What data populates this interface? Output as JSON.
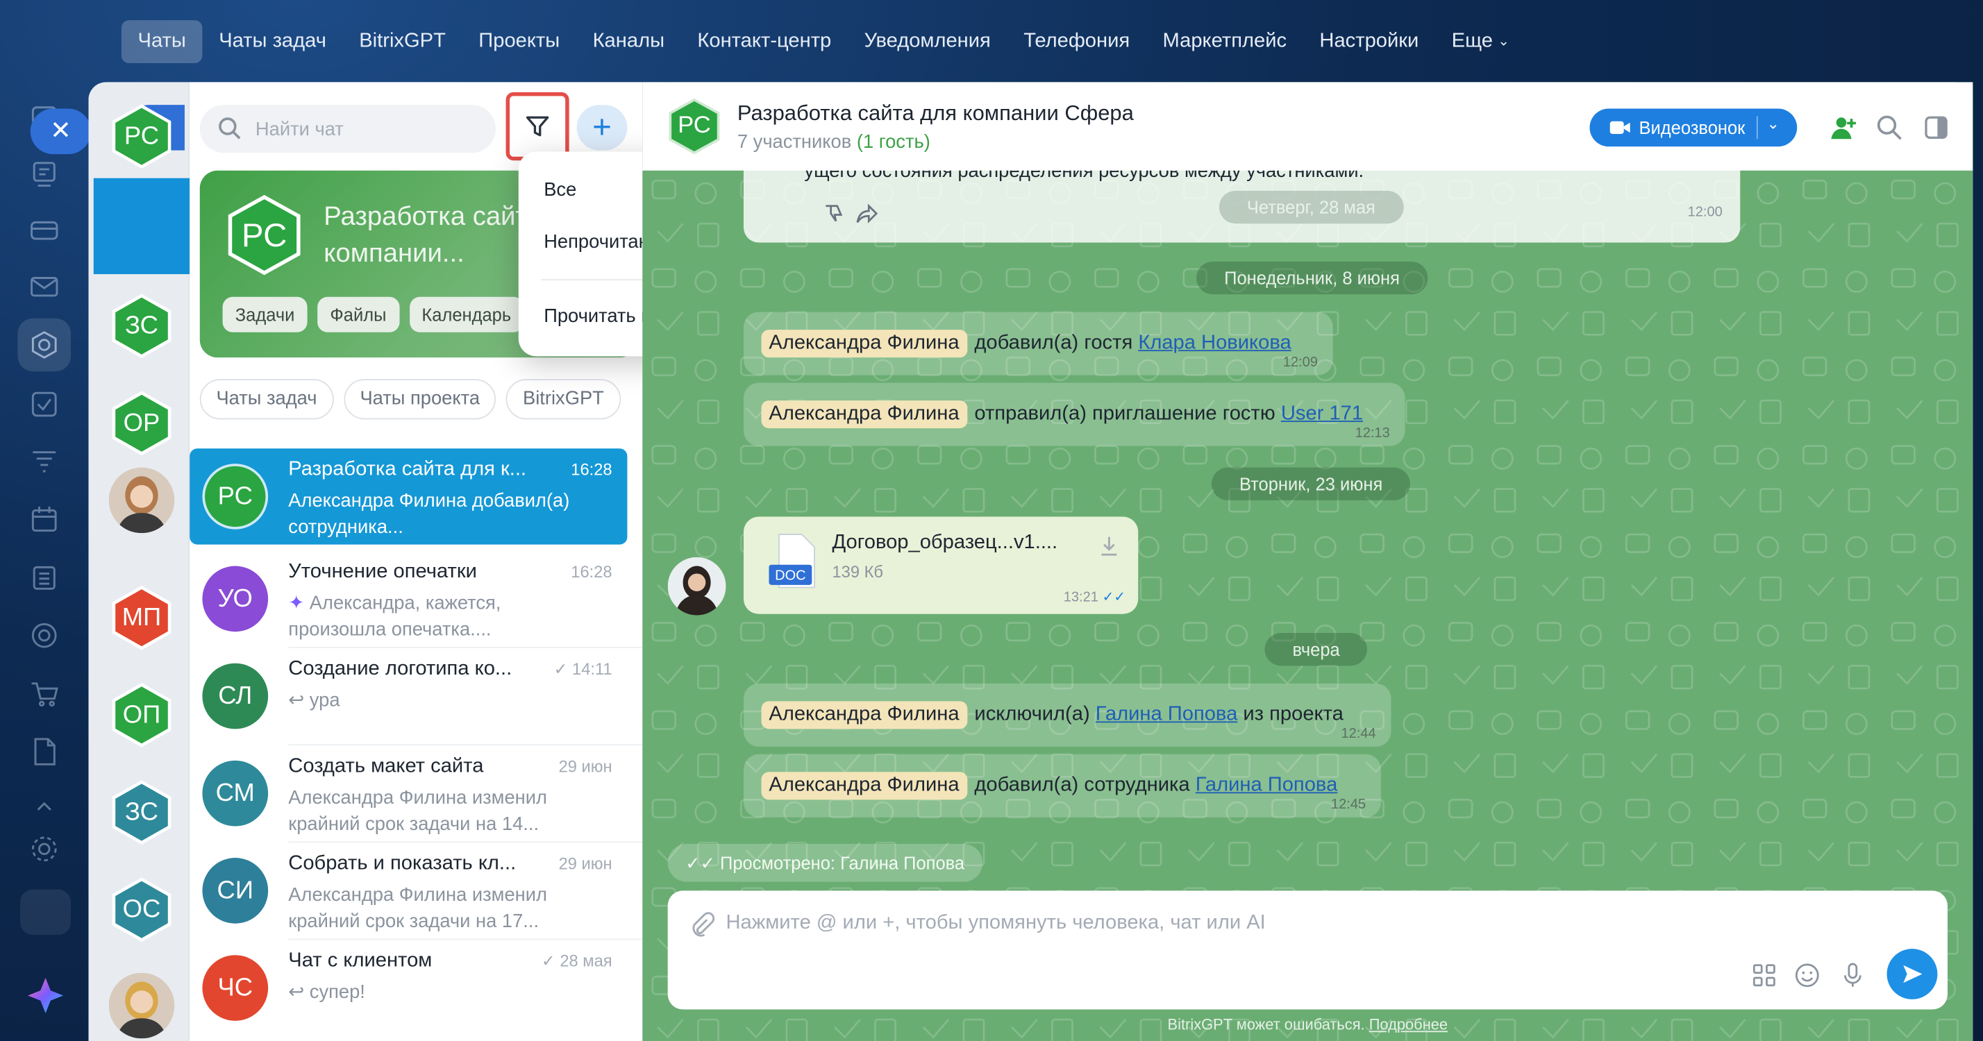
{
  "nav": {
    "items": [
      "Чаты",
      "Чаты задач",
      "BitrixGPT",
      "Проекты",
      "Каналы",
      "Контакт-центр",
      "Уведомления",
      "Телефония",
      "Маркетплейс",
      "Настройки"
    ],
    "more": "Еще",
    "active_index": 0
  },
  "rail": {
    "icons": [
      "chat-icon",
      "tasks-icon",
      "card-icon",
      "mail-icon",
      "hexagon-icon",
      "checkbox-icon",
      "filter-funnel-icon",
      "calendar-icon",
      "building-icon",
      "target-icon",
      "cart-icon",
      "document-icon",
      "chevron-up-icon",
      "gear-icon",
      "copilot-icon"
    ]
  },
  "recent": {
    "items": [
      {
        "initials": "РС",
        "color": "#2aa541",
        "shape": "hexagon",
        "selected": true
      },
      {
        "initials": "ЗС",
        "color": "#2aa541",
        "shape": "hexagon"
      },
      {
        "initials": "ОР",
        "color": "#2aa541",
        "shape": "hexagon"
      },
      {
        "initials": "",
        "color": "#b27a4d",
        "shape": "photo"
      },
      {
        "initials": "МП",
        "color": "#e2462e",
        "shape": "hexagon"
      },
      {
        "initials": "ОП",
        "color": "#2aa541",
        "shape": "hexagon"
      },
      {
        "initials": "ЗС",
        "color": "#2e8a9a",
        "shape": "hexagon"
      },
      {
        "initials": "ОС",
        "color": "#2e8a9a",
        "shape": "hexagon"
      },
      {
        "initials": "",
        "color": "#d9a84a",
        "shape": "photo"
      }
    ]
  },
  "search": {
    "placeholder": "Найти чат"
  },
  "hero": {
    "initials": "РС",
    "title": "Разработка сайта для компании...",
    "chips": [
      "Задачи",
      "Файлы",
      "Календарь"
    ]
  },
  "list_filters": [
    "Чаты задач",
    "Чаты проекта",
    "BitrixGPT"
  ],
  "chats": [
    {
      "initials": "РС",
      "color": "#2aa541",
      "title": "Разработка сайта для к...",
      "time": "16:28",
      "sub": "Александра Филина добавил(а) сотрудника...",
      "selected": true,
      "checked": false
    },
    {
      "initials": "УО",
      "color": "#8a4bd6",
      "title": "Уточнение опечатки",
      "time": "16:28",
      "sub": "Александра, кажется, произошла опечатка....",
      "checked": false
    },
    {
      "initials": "СЛ",
      "color": "#2d8a55",
      "title": "Создание логотипа ко...",
      "time": "14:11",
      "sub": "ура",
      "checked": true
    },
    {
      "initials": "СМ",
      "color": "#2e8a9a",
      "title": "Создать макет сайта",
      "time": "29 июн",
      "sub": "Александра Филина изменил крайний срок задачи на 14...",
      "checked": false
    },
    {
      "initials": "СИ",
      "color": "#2e7f9a",
      "title": "Собрать и показать кл...",
      "time": "29 июн",
      "sub": "Александра Филина изменил крайний срок задачи на 17...",
      "checked": false
    },
    {
      "initials": "ЧС",
      "color": "#e2462e",
      "title": "Чат с клиентом",
      "time": "28 мая",
      "sub": "супер!",
      "checked": true
    }
  ],
  "dropdown": {
    "all": "Все",
    "unread": "Непрочитанные",
    "read_all": "Прочитать всё",
    "selected": "all"
  },
  "chat": {
    "initials": "РС",
    "title": "Разработка сайта для компании Сфера",
    "members": "7 участников",
    "guests": "(1 гость)",
    "video_label": "Видеозвонок",
    "partial_text": "ущего состояния распределения ресурсов между участниками.",
    "partial_time": "12:00",
    "dates": [
      "Четверг, 28 мая",
      "Понедельник, 8 июня",
      "Вторник, 23 июня",
      "вчера"
    ],
    "system_messages": [
      {
        "name": "Александра Филина",
        "action": "добавил(а) гостя",
        "link": "Клара Новикова",
        "tail": "",
        "time": "12:09"
      },
      {
        "name": "Александра Филина",
        "action": "отправил(а) приглашение гостю",
        "link": "User 171",
        "tail": "",
        "time": "12:13"
      },
      {
        "name": "Александра Филина",
        "action": "исключил(а)",
        "link": "Галина Попова",
        "tail": "из проекта",
        "time": "12:44"
      },
      {
        "name": "Александра Филина",
        "action": "добавил(а) сотрудника",
        "link": "Галина Попова",
        "tail": "",
        "time": "12:45"
      }
    ],
    "file": {
      "name": "Договор_образец...v1....",
      "size": "139 Кб",
      "time": "13:21",
      "type": "DOC"
    },
    "seen": "Просмотрено: Галина Попова",
    "composer_placeholder": "Нажмите @ или +, чтобы упомянуть человека, чат или AI",
    "disclaimer": "BitrixGPT может ошибаться.",
    "disclaimer_link": "Подробнее"
  }
}
